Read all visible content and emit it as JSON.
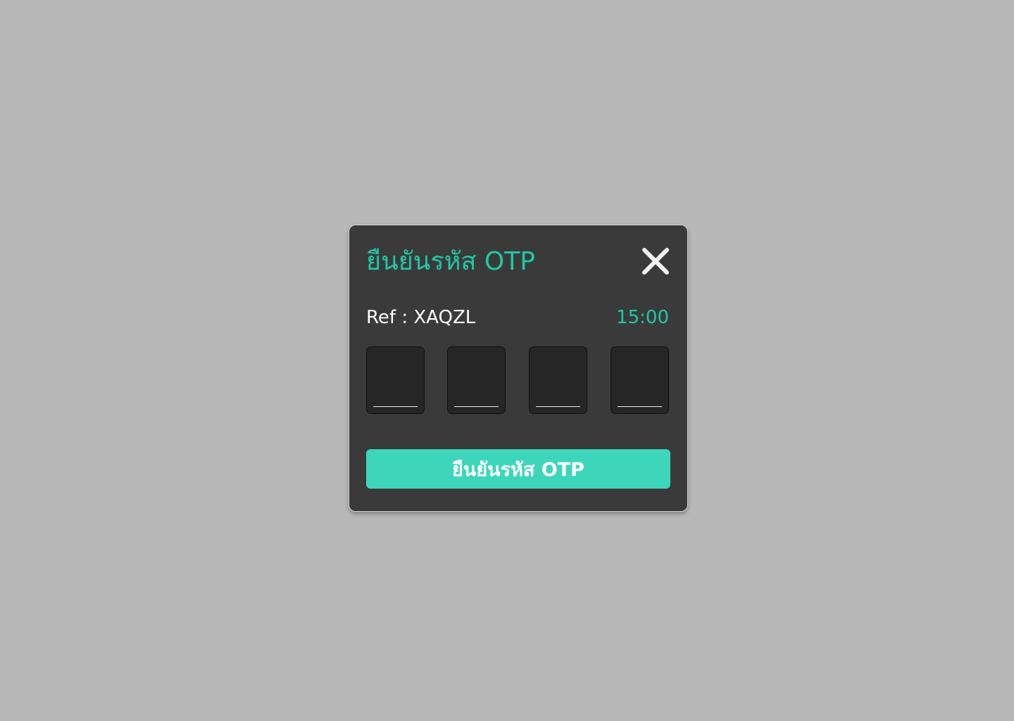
{
  "modal": {
    "title": "ยืนยันรหัส OTP",
    "ref_label": "Ref",
    "ref_separator": ":",
    "ref_code": "XAQZL",
    "timer": "15:00",
    "otp_digits": [
      "",
      "",
      "",
      ""
    ],
    "confirm_label": "ยืนยันรหัส OTP",
    "close_icon": "close-icon"
  },
  "colors": {
    "accent": "#1fc8a5",
    "button": "#3dd6bb",
    "modal_bg": "#3a3a3a",
    "page_bg": "#b8b8b8",
    "input_bg": "#262626"
  }
}
